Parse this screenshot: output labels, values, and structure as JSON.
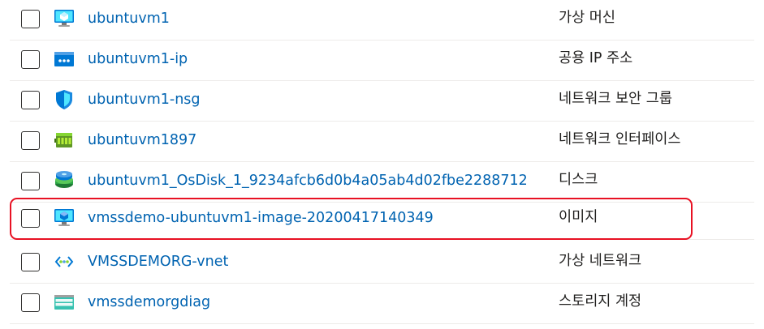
{
  "resources": [
    {
      "name": "ubuntuvm1",
      "type": "가상 머신",
      "icon": "virtual-machine-icon"
    },
    {
      "name": "ubuntuvm1-ip",
      "type": "공용 IP 주소",
      "icon": "public-ip-icon"
    },
    {
      "name": "ubuntuvm1-nsg",
      "type": "네트워크 보안 그룹",
      "icon": "network-security-group-icon"
    },
    {
      "name": "ubuntuvm1897",
      "type": "네트워크 인터페이스",
      "icon": "network-interface-icon"
    },
    {
      "name": "ubuntuvm1_OsDisk_1_9234afcb6d0b4a05ab4d02fbe2288712",
      "type": "디스크",
      "icon": "disk-icon"
    },
    {
      "name": "vmssdemo-ubuntuvm1-image-20200417140349",
      "type": "이미지",
      "icon": "image-icon",
      "highlighted": true
    },
    {
      "name": "VMSSDEMORG-vnet",
      "type": "가상 네트워크",
      "icon": "virtual-network-icon"
    },
    {
      "name": "vmssdemorgdiag",
      "type": "스토리지 계정",
      "icon": "storage-account-icon"
    }
  ],
  "colors": {
    "link": "#0063b1",
    "highlight_border": "#e81123",
    "separator": "#edebe9"
  }
}
